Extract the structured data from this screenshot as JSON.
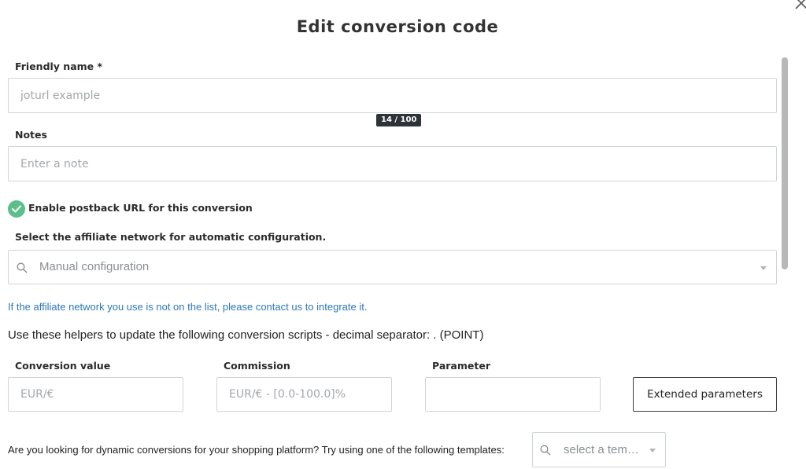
{
  "dialog": {
    "title": "Edit conversion code",
    "close_icon": "close-icon"
  },
  "friendly_name": {
    "label": "Friendly name *",
    "placeholder": "joturl example",
    "counter": "14 / 100"
  },
  "notes": {
    "label": "Notes",
    "placeholder": "Enter a note"
  },
  "postback": {
    "checked": true,
    "label": "Enable postback URL for this conversion",
    "accent": "#5cbf8a"
  },
  "network": {
    "label": "Select the affiliate network for automatic configuration.",
    "selected": "Manual configuration",
    "contact_text": "If the affiliate network you use is not on the list, please contact us to integrate it.",
    "link_color": "#2d77b8"
  },
  "helpers": {
    "text": "Use these helpers to update the following conversion scripts - decimal separator: . (POINT)",
    "conversion_value": {
      "label": "Conversion value",
      "placeholder": "EUR/€"
    },
    "commission": {
      "label": "Commission",
      "placeholder": "EUR/€ - [0.0-100.0]%"
    },
    "parameter": {
      "label": "Parameter",
      "placeholder": ""
    },
    "extended_button": "Extended parameters"
  },
  "templates": {
    "question": "Are you looking for dynamic conversions for your shopping platform? Try using one of the following templates:",
    "placeholder": "select a tem…"
  }
}
